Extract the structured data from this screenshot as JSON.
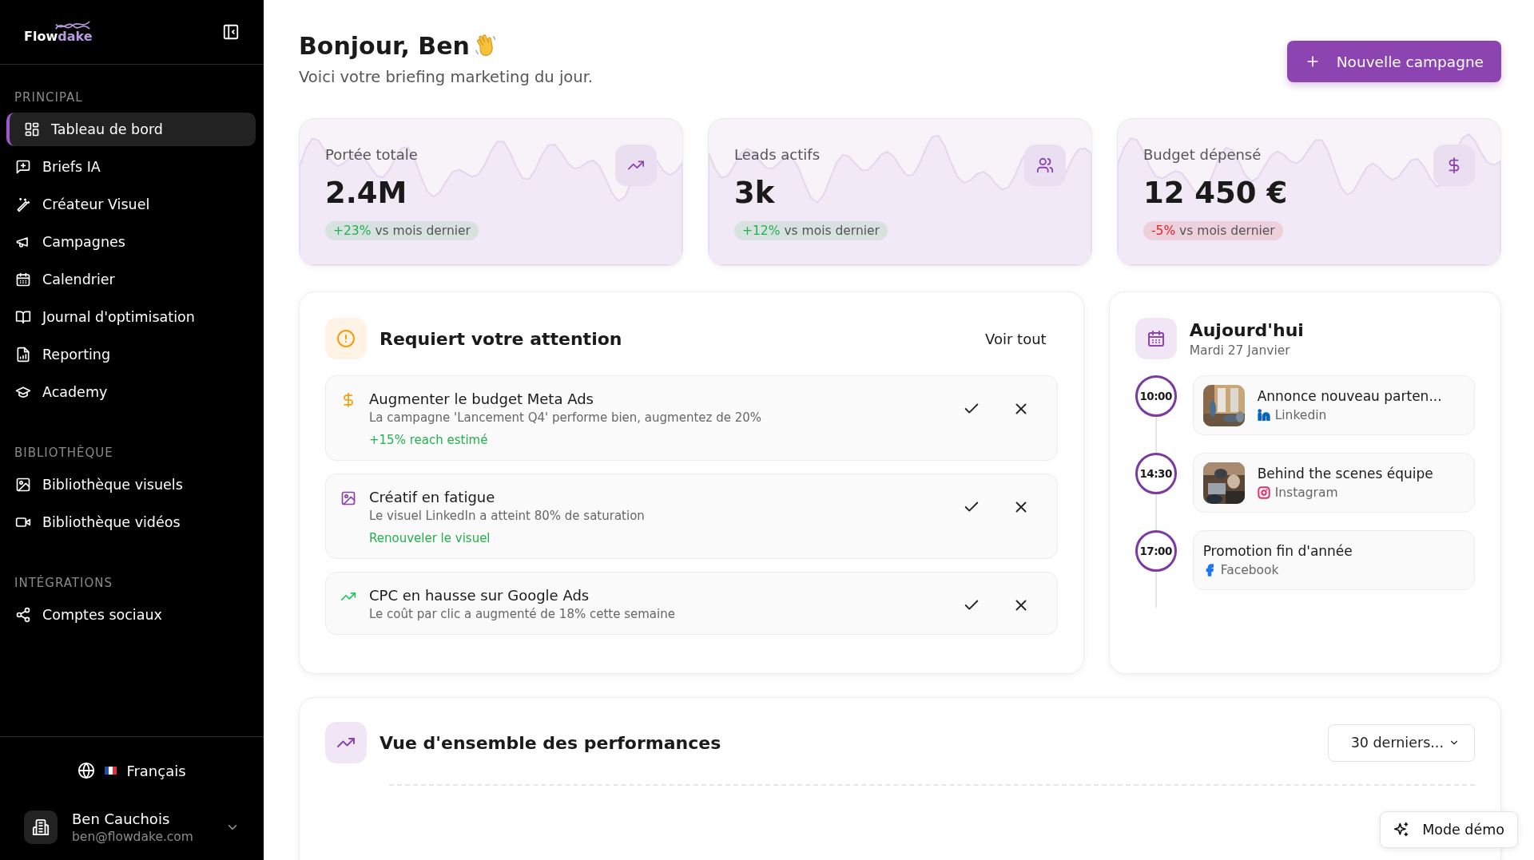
{
  "sidebar": {
    "logo": {
      "first": "Flow",
      "second": "dake"
    },
    "sections": [
      {
        "label": "PRINCIPAL",
        "items": [
          {
            "label": "Tableau de bord",
            "selected": true
          },
          {
            "label": "Briefs IA",
            "selected": false
          },
          {
            "label": "Créateur Visuel",
            "selected": false
          },
          {
            "label": "Campagnes",
            "selected": false
          },
          {
            "label": "Calendrier",
            "selected": false
          },
          {
            "label": "Journal d'optimisation",
            "selected": false
          },
          {
            "label": "Reporting",
            "selected": false
          },
          {
            "label": "Academy",
            "selected": false
          }
        ]
      },
      {
        "label": "BIBLIOTHÈQUE",
        "items": [
          {
            "label": "Bibliothèque visuels",
            "selected": false
          },
          {
            "label": "Bibliothèque vidéos",
            "selected": false
          }
        ]
      },
      {
        "label": "INTÉGRATIONS",
        "items": [
          {
            "label": "Comptes sociaux",
            "selected": false
          }
        ]
      }
    ],
    "language": "Français",
    "user": {
      "name": "Ben Cauchois",
      "email": "ben@flowdake.com"
    }
  },
  "header": {
    "title": "Bonjour, Ben",
    "subtitle": "Voici votre briefing marketing du jour.",
    "button": "Nouvelle campagne"
  },
  "stats": [
    {
      "label": "Portée totale",
      "value": "2.4M",
      "change": "+23%",
      "color": "#22b14c",
      "note": "vs mois dernier"
    },
    {
      "label": "Leads actifs",
      "value": "3k",
      "change": "+12%",
      "color": "#22b14c",
      "note": "vs mois dernier"
    },
    {
      "label": "Budget dépensé",
      "value": "12 450 €",
      "change": "-5%",
      "color": "#e0242a",
      "note": "vs mois dernier"
    }
  ],
  "attention": {
    "title": "Requiert votre attention",
    "link": "Voir tout",
    "items": [
      {
        "title": "Augmenter le budget Meta Ads",
        "description": "La campagne 'Lancement Q4' performe bien, augmentez de 20%",
        "action": "+15% reach estimé",
        "color": "#f59e0b"
      },
      {
        "title": "Créatif en fatigue",
        "description": "Le visuel LinkedIn a atteint 80% de saturation",
        "action": "Renouveler le visuel",
        "color": "#8b3fa8"
      },
      {
        "title": "CPC en hausse sur Google Ads",
        "description": "Le coût par clic a augmenté de 18% cette semaine",
        "color": "#22c55e"
      }
    ]
  },
  "today": {
    "title": "Aujourd'hui",
    "date": "Mardi 27 Janvier",
    "events": [
      {
        "time": "10:00",
        "title": "Annonce nouveau parten...",
        "platform": "Linkedin",
        "color": "#0a66c2"
      },
      {
        "time": "14:30",
        "title": "Behind the scenes équipe",
        "platform": "Instagram",
        "color": "#e1306c"
      },
      {
        "time": "17:00",
        "title": "Promotion fin d'année",
        "platform": "Facebook",
        "color": "#1877f2"
      }
    ]
  },
  "performance": {
    "title": "Vue d'ensemble des performances",
    "period": "30 derniers..."
  },
  "demo_button": "Mode démo"
}
